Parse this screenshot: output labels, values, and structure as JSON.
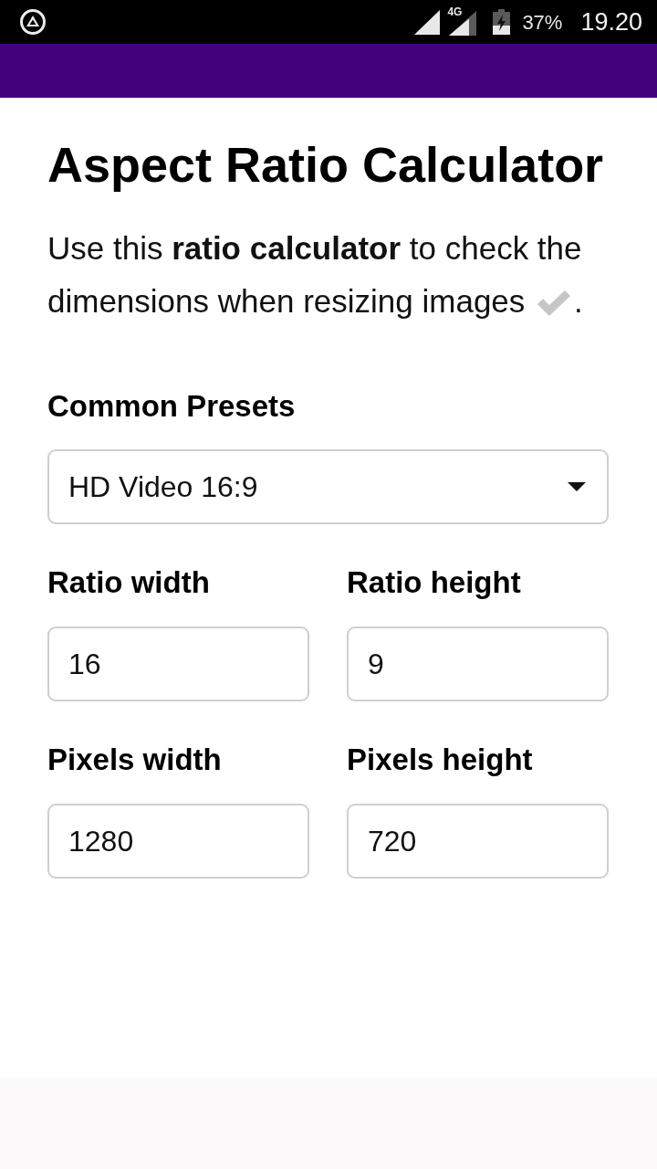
{
  "status_bar": {
    "network_type": "4G",
    "battery": "37%",
    "time": "19.20"
  },
  "title": "Aspect Ratio Calculator",
  "description": {
    "text": "Use this **ratio calculator** to check the dimensions when resizing images",
    "after_icon": "."
  },
  "presets": {
    "label": "Common Presets",
    "value": "HD Video 16:9"
  },
  "field_rows": [
    [
      {
        "label": "Ratio width",
        "value": "16"
      },
      {
        "label": "Ratio height",
        "value": "9"
      }
    ],
    [
      {
        "label": "Pixels width",
        "value": "1280"
      },
      {
        "label": "Pixels height",
        "value": "720"
      }
    ]
  ]
}
